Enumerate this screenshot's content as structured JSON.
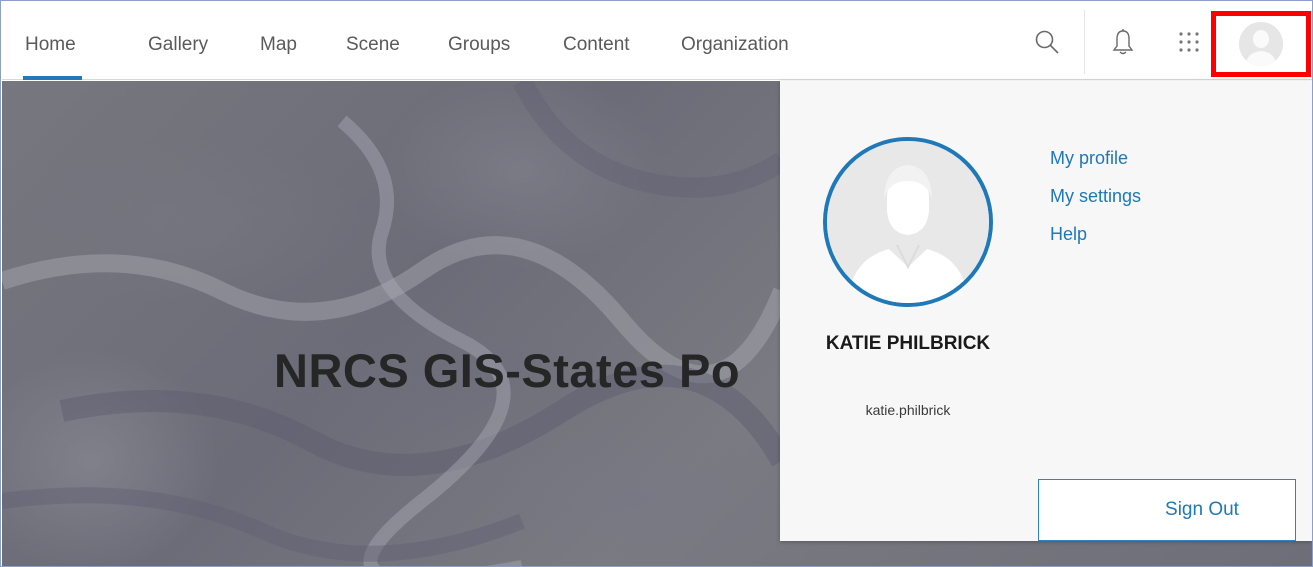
{
  "nav": {
    "items": [
      {
        "label": "Home",
        "active": true
      },
      {
        "label": "Gallery"
      },
      {
        "label": "Map"
      },
      {
        "label": "Scene"
      },
      {
        "label": "Groups"
      },
      {
        "label": "Content"
      },
      {
        "label": "Organization"
      }
    ],
    "icons": [
      "search-icon",
      "bell-icon",
      "app-launcher-icon",
      "avatar"
    ]
  },
  "hero": {
    "title": "NRCS GIS-States Po"
  },
  "user_menu": {
    "name": "KATIE PHILBRICK",
    "username": "katie.philbrick",
    "links": [
      "My profile",
      "My settings",
      "Help"
    ],
    "sign_out": "Sign Out"
  },
  "colors": {
    "accent": "#1f78b7",
    "highlight_box": "#ff0000",
    "nav_text": "#5a5a5a"
  }
}
